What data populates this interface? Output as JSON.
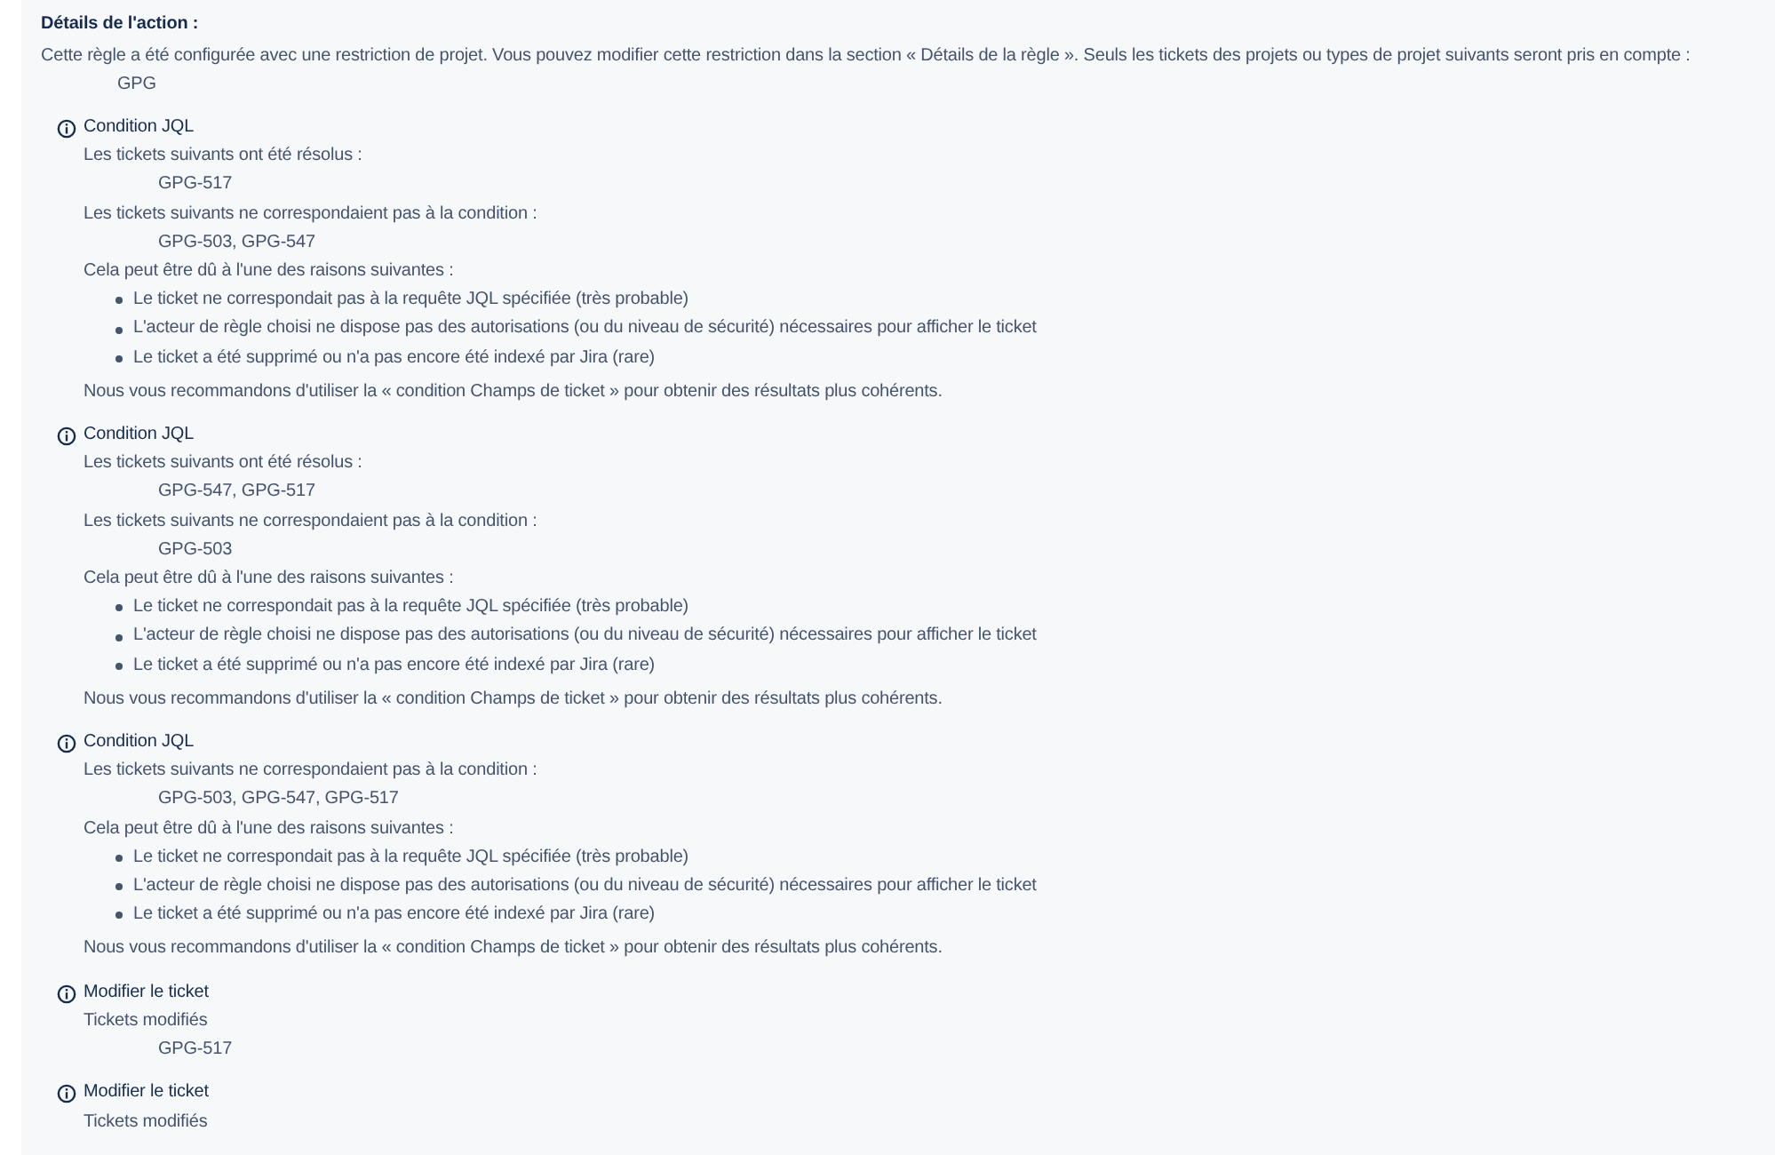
{
  "heading": "Détails de l'action :",
  "description": "Cette règle a été configurée avec une restriction de projet. Vous pouvez modifier cette restriction dans la section « Détails de la règle ». Seuls les tickets des projets ou types de projet suivants seront pris en compte :",
  "projects": "GPG",
  "entries": [
    {
      "title": "Condition JQL",
      "sections": [
        {
          "label": "Les tickets suivants ont été résolus :",
          "value": "GPG-517"
        },
        {
          "label": "Les tickets suivants ne correspondaient pas à la condition :",
          "value": "GPG-503, GPG-547"
        }
      ],
      "reasons_label": "Cela peut être dû à l'une des raisons suivantes :",
      "reasons": [
        "Le ticket ne correspondait pas à la requête JQL spécifiée (très probable)",
        "L'acteur de règle choisi ne dispose pas des autorisations (ou du niveau de sécurité) nécessaires pour afficher le ticket",
        "Le ticket a été supprimé ou n'a pas encore été indexé par Jira (rare)"
      ],
      "note": "Nous vous recommandons d'utiliser la « condition Champs de ticket » pour obtenir des résultats plus cohérents."
    },
    {
      "title": "Condition JQL",
      "sections": [
        {
          "label": "Les tickets suivants ont été résolus :",
          "value": "GPG-547, GPG-517"
        },
        {
          "label": "Les tickets suivants ne correspondaient pas à la condition :",
          "value": "GPG-503"
        }
      ],
      "reasons_label": "Cela peut être dû à l'une des raisons suivantes :",
      "reasons": [
        "Le ticket ne correspondait pas à la requête JQL spécifiée (très probable)",
        "L'acteur de règle choisi ne dispose pas des autorisations (ou du niveau de sécurité) nécessaires pour afficher le ticket",
        "Le ticket a été supprimé ou n'a pas encore été indexé par Jira (rare)"
      ],
      "note": "Nous vous recommandons d'utiliser la « condition Champs de ticket » pour obtenir des résultats plus cohérents."
    },
    {
      "title": "Condition JQL",
      "sections": [
        {
          "label": "Les tickets suivants ne correspondaient pas à la condition :",
          "value": "GPG-503, GPG-547, GPG-517"
        }
      ],
      "reasons_label": "Cela peut être dû à l'une des raisons suivantes :",
      "reasons": [
        "Le ticket ne correspondait pas à la requête JQL spécifiée (très probable)",
        "L'acteur de règle choisi ne dispose pas des autorisations (ou du niveau de sécurité) nécessaires pour afficher le ticket",
        "Le ticket a été supprimé ou n'a pas encore été indexé par Jira (rare)"
      ],
      "note": "Nous vous recommandons d'utiliser la « condition Champs de ticket » pour obtenir des résultats plus cohérents."
    },
    {
      "title": "Modifier le ticket",
      "sections": [
        {
          "label": "Tickets modifiés",
          "value": "GPG-517"
        }
      ]
    },
    {
      "title": "Modifier le ticket",
      "sections": [
        {
          "label": "Tickets modifiés"
        }
      ]
    }
  ]
}
